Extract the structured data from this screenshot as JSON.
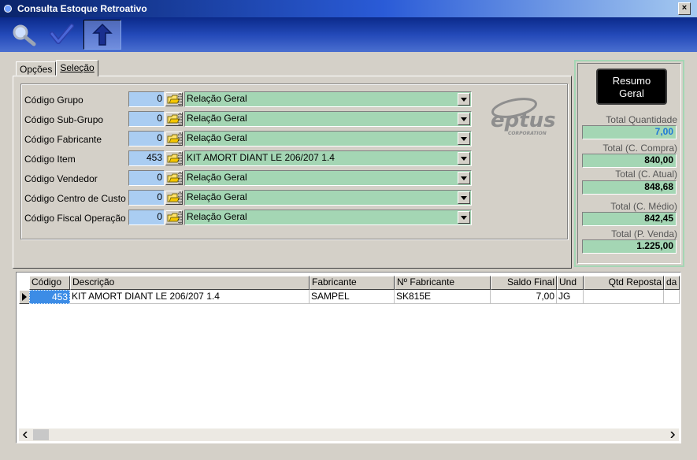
{
  "window": {
    "title": "Consulta Estoque Retroativo"
  },
  "toolbar": {
    "buttons": [
      {
        "icon": "magnifier-icon"
      },
      {
        "icon": "checkmark-icon"
      },
      {
        "icon": "up-arrow-icon"
      }
    ]
  },
  "tabs": [
    {
      "label": "Opções"
    },
    {
      "label": "Seleção"
    }
  ],
  "active_tab": "Seleção",
  "fields": [
    {
      "label": "Código Grupo",
      "code": "0",
      "value": "Relação Geral"
    },
    {
      "label": "Código Sub-Grupo",
      "code": "0",
      "value": "Relação Geral"
    },
    {
      "label": "Código Fabricante",
      "code": "0",
      "value": "Relação Geral"
    },
    {
      "label": "Código Item",
      "code": "453",
      "value": "KIT AMORT DIANT LE 206/207 1.4"
    },
    {
      "label": "Código Vendedor",
      "code": "0",
      "value": "Relação Geral"
    },
    {
      "label": "Código Centro de Custo",
      "code": "0",
      "value": "Relação Geral"
    },
    {
      "label": "Código Fiscal Operação",
      "code": "0",
      "value": "Relação Geral"
    }
  ],
  "logo": {
    "name": "eptus",
    "tagline": "CORPORATION"
  },
  "summary": {
    "button_line1": "Resumo",
    "button_line2": "Geral",
    "items": [
      {
        "label": "Total Quantidade",
        "value": "7,00"
      },
      {
        "label": "Total (C. Compra)",
        "value": "840,00"
      },
      {
        "label": "Total (C. Atual)",
        "value": "848,68"
      },
      {
        "label": "Total (C. Médio)",
        "value": "842,45"
      },
      {
        "label": "Total (P. Venda)",
        "value": "1.225,00"
      }
    ]
  },
  "grid": {
    "columns": [
      "Código",
      "Descrição",
      "Fabricante",
      "Nº Fabricante",
      "Saldo Final",
      "Und",
      "Qtd Reposta",
      "da"
    ],
    "rows": [
      [
        "453",
        "KIT AMORT DIANT LE 206/207 1.4",
        "SAMPEL",
        "SK815E",
        "7,00",
        "JG",
        "",
        ""
      ]
    ]
  },
  "colors": {
    "code_field": "#aacdf2",
    "combo_field": "#a4d6b4",
    "selected_cell": "#3c8ce6",
    "accent_value": "#1e78d8"
  }
}
